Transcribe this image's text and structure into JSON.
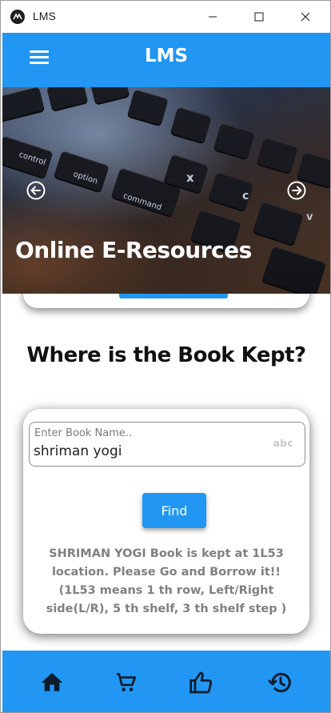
{
  "window": {
    "title": "LMS",
    "controls": [
      "minimize-icon",
      "maximize-icon",
      "close-icon"
    ]
  },
  "appbar": {
    "title": "LMS",
    "menu_icon": "hamburger-menu-icon",
    "color": "#2196f3"
  },
  "banner": {
    "caption": "Online E-Resources",
    "prev_icon": "arrow-left-circle-icon",
    "next_icon": "arrow-right-circle-icon",
    "keys": {
      "control": "control",
      "option": "option",
      "command": "command",
      "x": "x",
      "c": "c",
      "v": "v"
    }
  },
  "section": {
    "title": "Where is the Book Kept?"
  },
  "search": {
    "label": "Enter Book Name..",
    "value": "shriman yogi",
    "suffix_icon": "abc",
    "button_label": "Find"
  },
  "result": {
    "text": "SHRIMAN YOGI Book is kept at 1L53 location. Please Go and Borrow it!! (1L53 means 1 th row, Left/Right side(L/R), 5 th shelf, 3 th shelf step )"
  },
  "bottom_nav": {
    "items": [
      {
        "icon": "home-icon"
      },
      {
        "icon": "cart-icon"
      },
      {
        "icon": "thumb-up-icon"
      },
      {
        "icon": "history-icon"
      }
    ]
  }
}
